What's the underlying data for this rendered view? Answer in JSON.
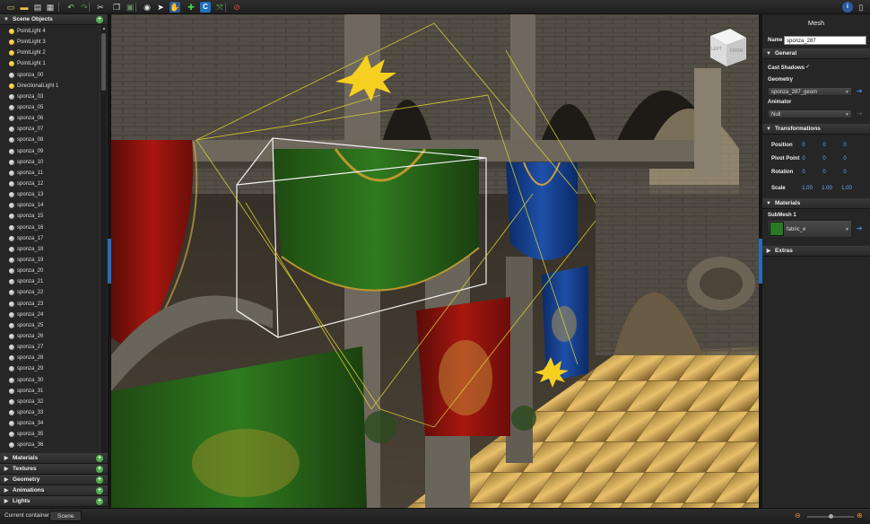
{
  "toolbar": {
    "icons": [
      {
        "name": "new-file-icon",
        "glyph": "▭",
        "color": "#e8d17a"
      },
      {
        "name": "open-folder-icon",
        "glyph": "▬",
        "color": "#e8c14a"
      },
      {
        "name": "export-icon",
        "glyph": "▤",
        "color": "#d8d8d8"
      },
      {
        "name": "save-icon",
        "glyph": "▦",
        "color": "#d0d0d0"
      },
      {
        "name": "undo-icon",
        "glyph": "↶",
        "color": "#9bd16a"
      },
      {
        "name": "redo-icon",
        "glyph": "↷",
        "color": "#5a8a4a"
      },
      {
        "name": "cut-icon",
        "glyph": "✂",
        "color": "#cfcfcf"
      },
      {
        "name": "copy-icon",
        "glyph": "❐",
        "color": "#d8d8d8"
      },
      {
        "name": "paste-icon",
        "glyph": "▣",
        "color": "#6d8f6a"
      },
      {
        "name": "visibility-eye-icon",
        "glyph": "◉",
        "color": "#e6e6e6"
      },
      {
        "name": "select-pointer-icon",
        "glyph": "➤",
        "color": "#ffffff"
      },
      {
        "name": "pan-hand-icon",
        "glyph": "✋",
        "color": "#f0a030"
      },
      {
        "name": "add-object-icon",
        "glyph": "✚",
        "color": "#4cd24c"
      },
      {
        "name": "rotate-icon",
        "glyph": "C",
        "color": "#4aa3ff"
      },
      {
        "name": "scale-icon",
        "glyph": "⤧",
        "color": "#4cd24c"
      },
      {
        "name": "delete-icon",
        "glyph": "⊘",
        "color": "#e04040"
      }
    ],
    "right_icons": [
      {
        "name": "help-info-icon",
        "glyph": "i",
        "color": "#4a8fe8"
      },
      {
        "name": "document-icon",
        "glyph": "▯",
        "color": "#d8d8d8"
      }
    ]
  },
  "left_panel": {
    "scene_objects_title": "Scene Objects",
    "objects": [
      {
        "label": "PointLight 4",
        "kind": "light"
      },
      {
        "label": "PointLight 3",
        "kind": "light"
      },
      {
        "label": "PointLight 2",
        "kind": "light"
      },
      {
        "label": "PointLight 1",
        "kind": "light"
      },
      {
        "label": "sponza_00",
        "kind": "mesh"
      },
      {
        "label": "DirectionalLight 1",
        "kind": "light"
      },
      {
        "label": "sponza_03",
        "kind": "mesh"
      },
      {
        "label": "sponza_05",
        "kind": "mesh"
      },
      {
        "label": "sponza_06",
        "kind": "mesh"
      },
      {
        "label": "sponza_07",
        "kind": "mesh"
      },
      {
        "label": "sponza_08",
        "kind": "mesh"
      },
      {
        "label": "sponza_09",
        "kind": "mesh"
      },
      {
        "label": "sponza_10",
        "kind": "mesh"
      },
      {
        "label": "sponza_11",
        "kind": "mesh"
      },
      {
        "label": "sponza_12",
        "kind": "mesh"
      },
      {
        "label": "sponza_13",
        "kind": "mesh"
      },
      {
        "label": "sponza_14",
        "kind": "mesh"
      },
      {
        "label": "sponza_15",
        "kind": "mesh"
      },
      {
        "label": "sponza_16",
        "kind": "mesh"
      },
      {
        "label": "sponza_17",
        "kind": "mesh"
      },
      {
        "label": "sponza_18",
        "kind": "mesh"
      },
      {
        "label": "sponza_19",
        "kind": "mesh"
      },
      {
        "label": "sponza_20",
        "kind": "mesh"
      },
      {
        "label": "sponza_21",
        "kind": "mesh"
      },
      {
        "label": "sponza_22",
        "kind": "mesh"
      },
      {
        "label": "sponza_23",
        "kind": "mesh"
      },
      {
        "label": "sponza_24",
        "kind": "mesh"
      },
      {
        "label": "sponza_25",
        "kind": "mesh"
      },
      {
        "label": "sponza_26",
        "kind": "mesh"
      },
      {
        "label": "sponza_27",
        "kind": "mesh"
      },
      {
        "label": "sponza_28",
        "kind": "mesh"
      },
      {
        "label": "sponza_29",
        "kind": "mesh"
      },
      {
        "label": "sponza_30",
        "kind": "mesh"
      },
      {
        "label": "sponza_31",
        "kind": "mesh"
      },
      {
        "label": "sponza_32",
        "kind": "mesh"
      },
      {
        "label": "sponza_33",
        "kind": "mesh"
      },
      {
        "label": "sponza_34",
        "kind": "mesh"
      },
      {
        "label": "sponza_35",
        "kind": "mesh"
      },
      {
        "label": "sponza_36",
        "kind": "mesh"
      }
    ],
    "sections": [
      "Materials",
      "Textures",
      "Geometry",
      "Animations",
      "Lights"
    ]
  },
  "viewport": {
    "gizmo_left": "LEFT",
    "gizmo_front": "FRON"
  },
  "right_panel": {
    "title": "Mesh",
    "name_label": "Name",
    "name_value": "sponza_287",
    "general": "General",
    "cast_shadows_label": "Cast Shadows",
    "cast_shadows_check": "✓",
    "geometry_label": "Geometry",
    "geometry_value": "sponza_287_geom",
    "animator_label": "Animator",
    "animator_value": "Null",
    "transformations": "Transformations",
    "position_label": "Position",
    "position": [
      "0",
      "0",
      "0"
    ],
    "pivot_label": "Pivot Point",
    "pivot": [
      "0",
      "0",
      "0"
    ],
    "rotation_label": "Rotation",
    "rotation": [
      "0",
      "0",
      "0"
    ],
    "scale_label": "Scale",
    "scale": [
      "1.00",
      "1.00",
      "1.00"
    ],
    "materials": "Materials",
    "submesh_label": "SubMesh 1",
    "material_value": "fabric_e",
    "extras": "Extras"
  },
  "status_bar": {
    "container_label": "Current container",
    "scene_tab": "Scene",
    "zoom_fraction": 0.5
  },
  "colors": {
    "accent_blue": "#1f6fbf",
    "add_green": "#4cae4c",
    "light_yellow": "#f5d020"
  }
}
